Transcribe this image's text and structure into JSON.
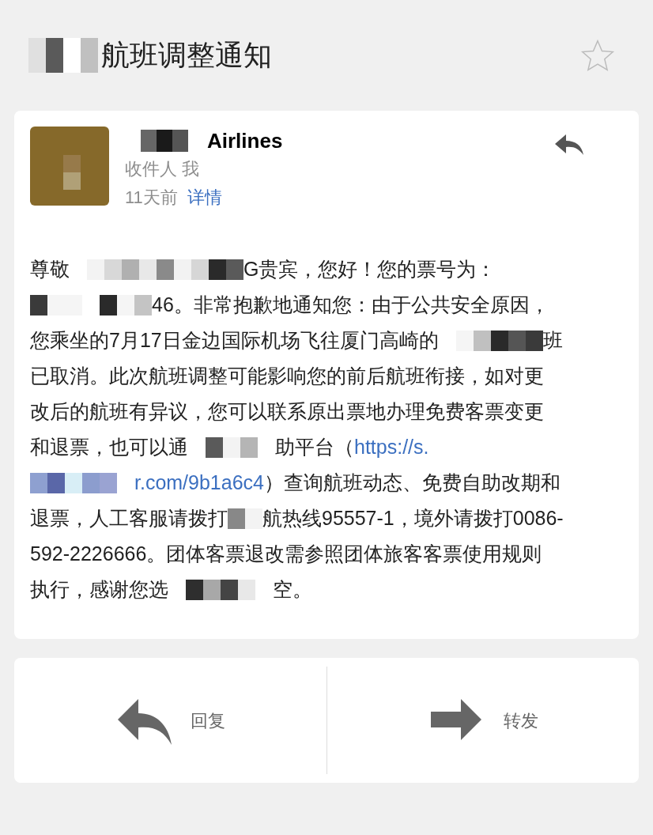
{
  "title": {
    "redacted": true,
    "text": "航班调整通知"
  },
  "starred": false,
  "message": {
    "sender": {
      "redacted": true,
      "name": "Airlines"
    },
    "recipient": "收件人 我",
    "time": "11天前",
    "details_link": "详情",
    "body_lines": [
      [
        {
          "kind": "text",
          "text": "尊敬"
        },
        {
          "kind": "mosaic"
        },
        {
          "kind": "text",
          "text": "G贵宾，您好！您的票号为："
        }
      ],
      [
        {
          "kind": "mosaic"
        },
        {
          "kind": "text",
          "text": "46。非常抱歉地通知您：由于公共安全原因，"
        }
      ],
      [
        {
          "kind": "text",
          "text": "您乘坐的7月17日金边国际机场飞往厦门高崎的"
        },
        {
          "kind": "mosaic"
        },
        {
          "kind": "text",
          "text": "班"
        }
      ],
      [
        {
          "kind": "text",
          "text": "已取消。此次航班调整可能影响您的前后航班衔接，如对更"
        }
      ],
      [
        {
          "kind": "text",
          "text": "改后的航班有异议，您可以联系原出票地办理免费客票变更"
        }
      ],
      [
        {
          "kind": "text",
          "text": "和退票，也可以通"
        },
        {
          "kind": "mosaic"
        },
        {
          "kind": "text",
          "text": "助平台（"
        },
        {
          "kind": "link",
          "text": "https://s."
        }
      ],
      [
        {
          "kind": "mosaic"
        },
        {
          "kind": "link",
          "text": "r.com/9b1a6c4"
        },
        {
          "kind": "text",
          "text": "）查询航班动态、免费自助改期和"
        }
      ],
      [
        {
          "kind": "text",
          "text": "退票，人工客服请拨打"
        },
        {
          "kind": "mosaic"
        },
        {
          "kind": "text",
          "text": "航热线95557-1，境外请拨打0086-"
        }
      ],
      [
        {
          "kind": "text",
          "text": "592-2226666。团体客票退改需参照团体旅客客票使用规则"
        }
      ],
      [
        {
          "kind": "text",
          "text": "执行，感谢您选"
        },
        {
          "kind": "mosaic"
        },
        {
          "kind": "text",
          "text": "空。"
        }
      ]
    ]
  },
  "actions": [
    {
      "kind": "reply",
      "label": "回复"
    },
    {
      "kind": "forward",
      "label": "转发"
    }
  ]
}
